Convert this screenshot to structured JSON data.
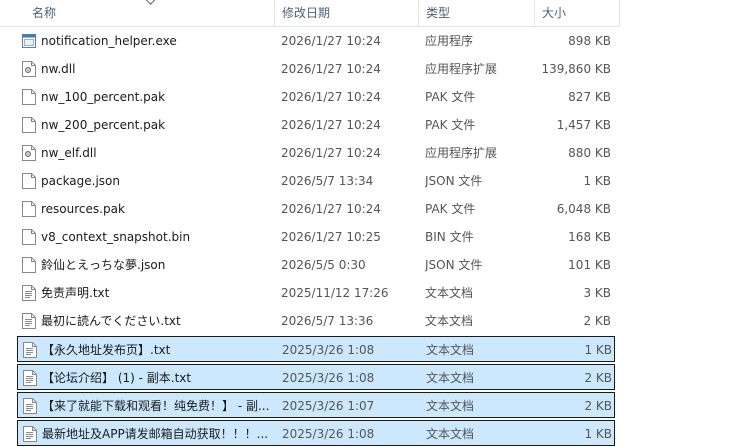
{
  "columns": {
    "name": "名称",
    "date": "修改日期",
    "type": "类型",
    "size": "大小"
  },
  "files": [
    {
      "name": "notification_helper.exe",
      "date": "2026/1/27 10:24",
      "type": "应用程序",
      "size": "898 KB",
      "icon": "exe-icon",
      "selected": false
    },
    {
      "name": "nw.dll",
      "date": "2026/1/27 10:24",
      "type": "应用程序扩展",
      "size": "139,860 KB",
      "icon": "dll-icon",
      "selected": false
    },
    {
      "name": "nw_100_percent.pak",
      "date": "2026/1/27 10:24",
      "type": "PAK 文件",
      "size": "827 KB",
      "icon": "file-icon",
      "selected": false
    },
    {
      "name": "nw_200_percent.pak",
      "date": "2026/1/27 10:24",
      "type": "PAK 文件",
      "size": "1,457 KB",
      "icon": "file-icon",
      "selected": false
    },
    {
      "name": "nw_elf.dll",
      "date": "2026/1/27 10:24",
      "type": "应用程序扩展",
      "size": "880 KB",
      "icon": "dll-icon",
      "selected": false
    },
    {
      "name": "package.json",
      "date": "2026/5/7 13:34",
      "type": "JSON 文件",
      "size": "1 KB",
      "icon": "file-icon",
      "selected": false
    },
    {
      "name": "resources.pak",
      "date": "2026/1/27 10:24",
      "type": "PAK 文件",
      "size": "6,048 KB",
      "icon": "file-icon",
      "selected": false
    },
    {
      "name": "v8_context_snapshot.bin",
      "date": "2026/1/27 10:25",
      "type": "BIN 文件",
      "size": "168 KB",
      "icon": "file-icon",
      "selected": false
    },
    {
      "name": "鈴仙とえっちな夢.json",
      "date": "2026/5/5 0:30",
      "type": "JSON 文件",
      "size": "101 KB",
      "icon": "file-icon",
      "selected": false
    },
    {
      "name": "免责声明.txt",
      "date": "2025/11/12 17:26",
      "type": "文本文档",
      "size": "3 KB",
      "icon": "text-file-icon",
      "selected": false
    },
    {
      "name": "最初に読んでください.txt",
      "date": "2026/5/7 13:36",
      "type": "文本文档",
      "size": "2 KB",
      "icon": "text-file-icon",
      "selected": false
    },
    {
      "name": "【永久地址发布页】.txt",
      "date": "2025/3/26 1:08",
      "type": "文本文档",
      "size": "1 KB",
      "icon": "text-file-icon",
      "selected": true
    },
    {
      "name": "【论坛介绍】 (1) - 副本.txt",
      "date": "2025/3/26 1:08",
      "type": "文本文档",
      "size": "2 KB",
      "icon": "text-file-icon",
      "selected": true
    },
    {
      "name": "【来了就能下载和观看！纯免费！】 - 副...",
      "date": "2025/3/26 1:07",
      "type": "文本文档",
      "size": "2 KB",
      "icon": "text-file-icon",
      "selected": true
    },
    {
      "name": "最新地址及APP请发邮箱自动获取！！！...",
      "date": "2025/3/26 1:08",
      "type": "文本文档",
      "size": "1 KB",
      "icon": "text-file-icon",
      "selected": true
    }
  ]
}
